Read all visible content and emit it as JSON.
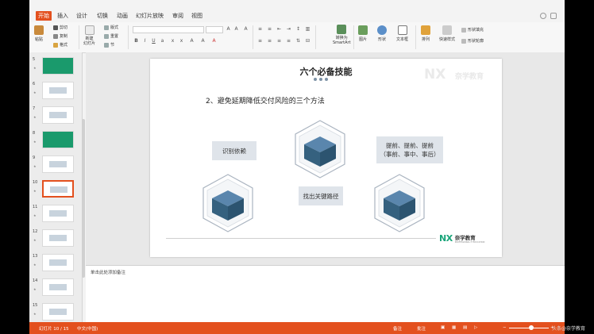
{
  "ribbon_tabs": [
    "开始",
    "插入",
    "设计",
    "切换",
    "动画",
    "幻灯片放映",
    "审阅",
    "视图"
  ],
  "ribbon": {
    "paste": "粘贴",
    "cut": "剪切",
    "copy": "复制",
    "format": "格式",
    "new_slide": "新建\n幻灯片",
    "layout": "版式",
    "reset": "重置",
    "section": "节",
    "smartart": "转换为\nSmartArt",
    "picture": "图片",
    "shape": "形状",
    "textbox": "文本框",
    "arrange": "排列",
    "quick_style": "快速样式",
    "shape_fill": "形状填充",
    "shape_outline": "形状轮廓"
  },
  "thumbnails": [
    {
      "num": "5"
    },
    {
      "num": "6"
    },
    {
      "num": "7"
    },
    {
      "num": "8"
    },
    {
      "num": "9"
    },
    {
      "num": "10"
    },
    {
      "num": "11"
    },
    {
      "num": "12"
    },
    {
      "num": "13"
    },
    {
      "num": "14"
    },
    {
      "num": "15"
    }
  ],
  "slide": {
    "title": "六个必备技能",
    "subtitle": "2、避免延期降低交付风险的三个方法",
    "label1": "识别依赖",
    "label2_line1": "提前、提前、提前",
    "label2_line2": "（事前、事中、事后）",
    "label3": "找出关键路径",
    "logo_ghost_mark": "NX",
    "logo_ghost_name": "奈学教育",
    "brand_mark": "NX",
    "brand_name": "奈学教育",
    "brand_sub": "PROFESSIONAL IT EDUCATION"
  },
  "notes_placeholder": "单击此处添加备注",
  "status": {
    "slide_info": "幻灯片 10 / 15",
    "language": "中文(中国)",
    "notes": "备注",
    "comments": "批注",
    "zoom": "88%"
  },
  "watermark": "头条@奈学教育",
  "colors": {
    "accent": "#e3501e",
    "cube_top": "#3f6a8f",
    "brand_green": "#1aa57a"
  }
}
